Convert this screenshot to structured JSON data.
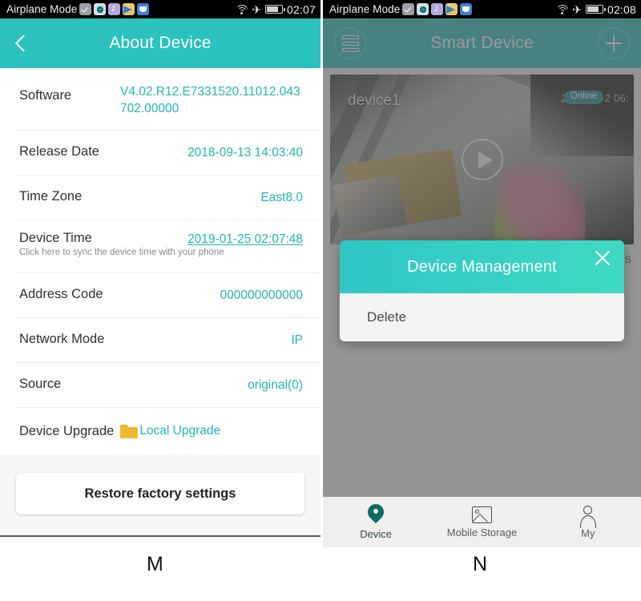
{
  "panel_m": {
    "status_bar": {
      "label": "Airplane Mode",
      "icons": [
        "check-icon",
        "camera-icon",
        "music-icon",
        "telegram-icon",
        "bird-icon"
      ],
      "right_icons": [
        "wifi-icon",
        "airplane-icon",
        "battery-icon"
      ],
      "time": "02:07"
    },
    "appbar": {
      "back_icon": "chevron-left-icon",
      "title": "About Device"
    },
    "rows": [
      {
        "label": "Software",
        "value": "V4.02.R12.E7331520.11012.043702.00000"
      },
      {
        "label": "Release Date",
        "value": "2018-09-13 14:03:40"
      },
      {
        "label": "Time Zone",
        "value": "East8.0"
      },
      {
        "label": "Address Code",
        "value": "000000000000"
      },
      {
        "label": "Network Mode",
        "value": "IP"
      },
      {
        "label": "Source",
        "value": "original(0)"
      }
    ],
    "device_time": {
      "label": "Device Time",
      "value": "2019-01-25 02:07:48",
      "hint": "Click here to sync the device time with your phone"
    },
    "device_upgrade": {
      "label": "Device Upgrade",
      "folder_icon": "folder-icon",
      "link": "Local Upgrade"
    },
    "restore_button": "Restore factory settings",
    "caption": "M"
  },
  "panel_n": {
    "status_bar": {
      "label": "Airplane Mode",
      "time": "02:08"
    },
    "appbar": {
      "menu_icon": "hamburger-icon",
      "title": "Smart Device",
      "add_icon": "plus-icon"
    },
    "device_card": {
      "name": "device1",
      "timestamp": "2019-04-2     06:",
      "status_badge": "Online",
      "play_icon": "play-icon"
    },
    "behind_text": "gs",
    "dialog": {
      "title": "Device Management",
      "close_icon": "close-icon",
      "items": [
        "Delete"
      ]
    },
    "bottom_nav": [
      {
        "label": "Device",
        "icon": "location-pin-icon",
        "active": true
      },
      {
        "label": "Mobile Storage",
        "icon": "image-icon",
        "active": false
      },
      {
        "label": "My",
        "icon": "person-icon",
        "active": false
      }
    ],
    "caption": "N"
  },
  "colors": {
    "teal": "#2bc2bd",
    "teal_value": "#23b6b1",
    "dialog_gradient_start": "#2fc6c4",
    "dialog_gradient_end": "#3fd9c3",
    "active_nav": "#0c6e63"
  }
}
